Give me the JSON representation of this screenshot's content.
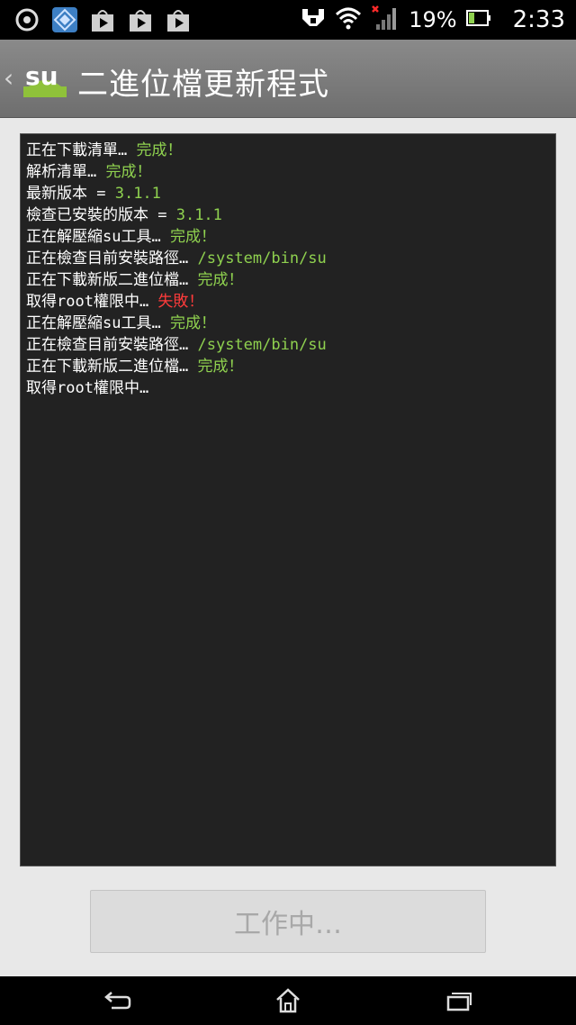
{
  "status_bar": {
    "battery_percent": "19%",
    "time": "2:33",
    "icons": [
      "sync-circle-icon",
      "app-grid-icon",
      "play-store-icon",
      "play-store-icon",
      "play-store-icon",
      "usb-icon",
      "wifi-icon",
      "signal-icon",
      "battery-icon"
    ]
  },
  "action_bar": {
    "logo_text": "su",
    "title": "二進位檔更新程式"
  },
  "console": {
    "lines": [
      {
        "text": "正在下載清單… ",
        "status": "完成！",
        "status_type": "ok"
      },
      {
        "text": "解析清單… ",
        "status": "完成！",
        "status_type": "ok"
      },
      {
        "text": "最新版本 = ",
        "status": "3.1.1",
        "status_type": "ok"
      },
      {
        "text": "檢查已安裝的版本 = ",
        "status": "3.1.1",
        "status_type": "ok"
      },
      {
        "text": "正在解壓縮su工具… ",
        "status": "完成！",
        "status_type": "ok"
      },
      {
        "text": "正在檢查目前安裝路徑… ",
        "status": "/system/bin/su",
        "status_type": "ok"
      },
      {
        "text": "正在下載新版二進位檔… ",
        "status": "完成！",
        "status_type": "ok"
      },
      {
        "text": "取得root權限中… ",
        "status": "失敗！",
        "status_type": "fail"
      },
      {
        "text": "正在解壓縮su工具… ",
        "status": "完成！",
        "status_type": "ok"
      },
      {
        "text": "正在檢查目前安裝路徑… ",
        "status": "/system/bin/su",
        "status_type": "ok"
      },
      {
        "text": "正在下載新版二進位檔… ",
        "status": "完成！",
        "status_type": "ok"
      },
      {
        "text": "取得root權限中…",
        "status": "",
        "status_type": "ok"
      }
    ]
  },
  "button": {
    "label": "工作中…"
  },
  "colors": {
    "ok": "#8fd14f",
    "fail": "#ff3b3b",
    "console_bg": "#222222"
  }
}
